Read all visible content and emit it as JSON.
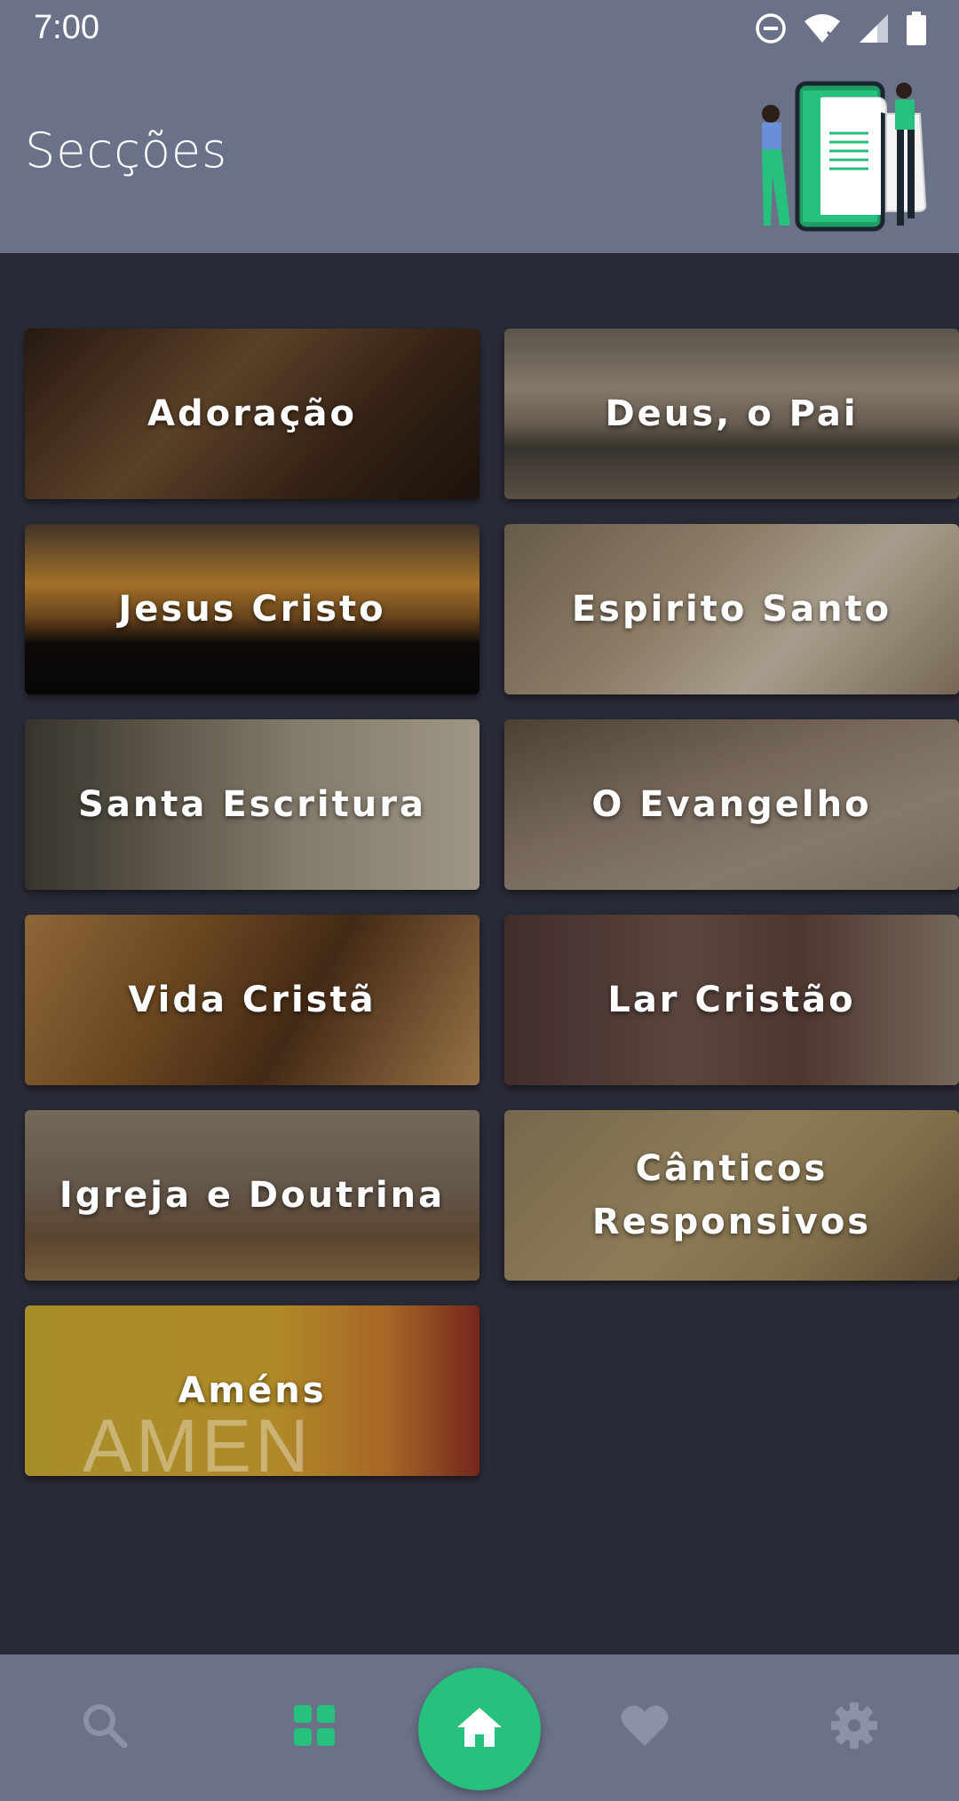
{
  "status_bar": {
    "time": "7:00",
    "icons": [
      "do-not-disturb-icon",
      "wifi-icon",
      "signal-icon",
      "battery-icon"
    ]
  },
  "header": {
    "title": "Secções",
    "illustration": "people-with-phone-illustration"
  },
  "sections": [
    {
      "label": "Adoração",
      "bg": "praying-hands"
    },
    {
      "label": "Deus, o Pai",
      "bg": "sunset-sea"
    },
    {
      "label": "Jesus Cristo",
      "bg": "crosses-sunset"
    },
    {
      "label": "Espirito Santo",
      "bg": "dove"
    },
    {
      "label": "Santa Escritura",
      "bg": "open-bible"
    },
    {
      "label": "O Evangelho",
      "bg": "nail"
    },
    {
      "label": "Vida Cristã",
      "bg": "worship-face"
    },
    {
      "label": "Lar Cristão",
      "bg": "man-reading"
    },
    {
      "label": "Igreja e Doutrina",
      "bg": "church-pews"
    },
    {
      "label": "Cânticos Responsivos",
      "bg": "sheet-music"
    },
    {
      "label": "Améns",
      "bg": "amen-text",
      "overlay_text": "AMEN"
    }
  ],
  "bottom_nav": {
    "items": [
      "search-icon",
      "grid-icon",
      "home-icon",
      "heart-icon",
      "gear-icon"
    ],
    "active": "grid-icon"
  },
  "colors": {
    "header_bg": "#6a7189",
    "page_bg": "#282a36",
    "accent": "#25c17d",
    "nav_inactive": "#8a91a8"
  }
}
